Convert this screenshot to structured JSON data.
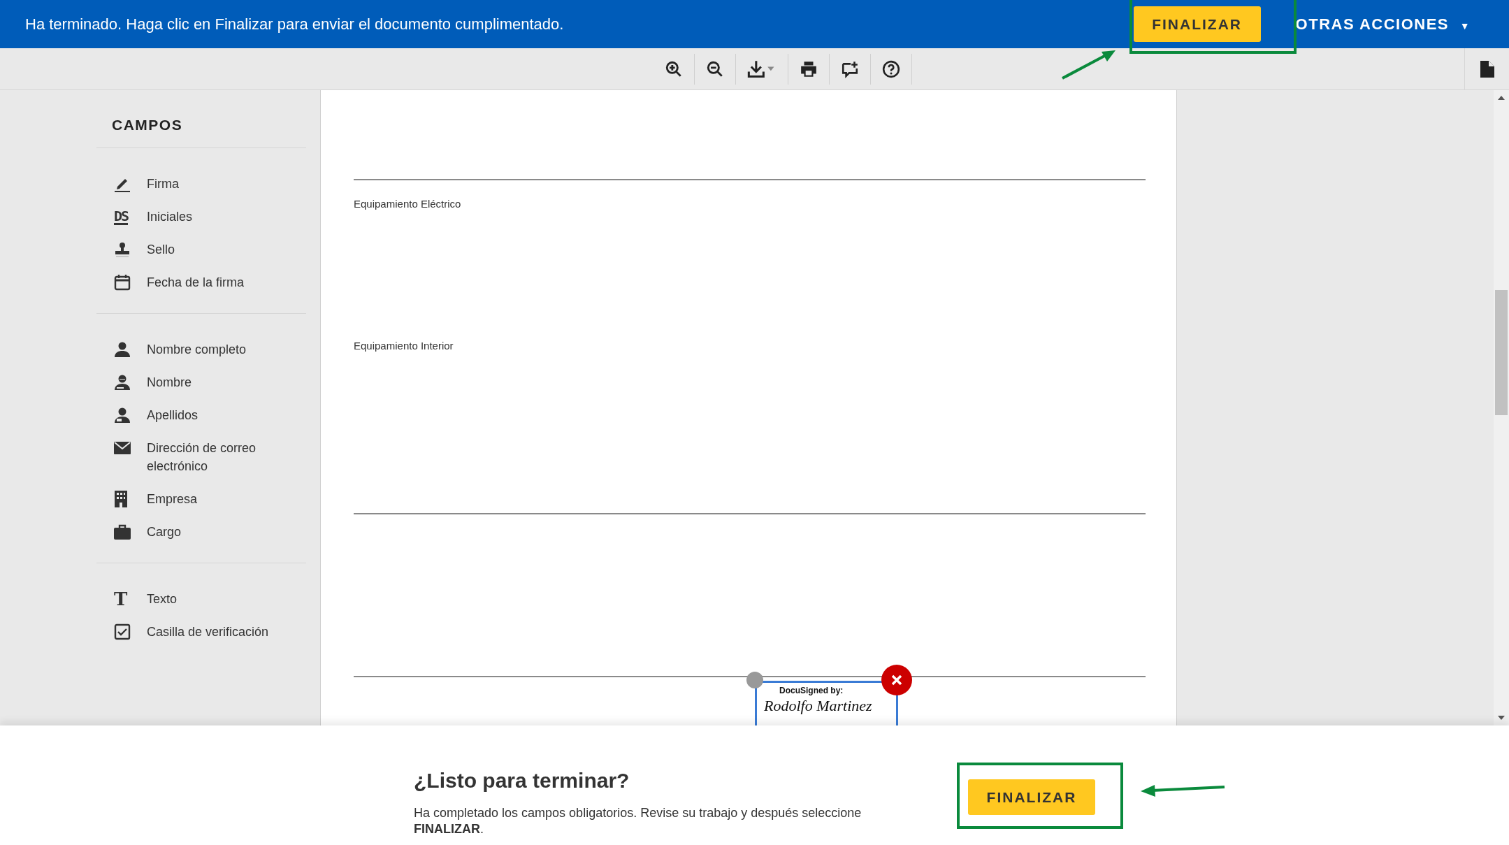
{
  "banner": {
    "message": "Ha terminado. Haga clic en Finalizar para enviar el documento cumplimentado.",
    "finish_button": "FINALIZAR",
    "more_actions": "OTRAS ACCIONES",
    "more_actions_caret": "▼"
  },
  "sidebar": {
    "title": "CAMPOS",
    "groups": [
      [
        {
          "label": "Firma",
          "kind": "signature"
        },
        {
          "label": "Iniciales",
          "kind": "initials",
          "icon_text": "DS"
        },
        {
          "label": "Sello",
          "kind": "stamp"
        },
        {
          "label": "Fecha de la firma",
          "kind": "date"
        }
      ],
      [
        {
          "label": "Nombre completo",
          "kind": "person"
        },
        {
          "label": "Nombre",
          "kind": "person-first"
        },
        {
          "label": "Apellidos",
          "kind": "person-last"
        },
        {
          "label": "Dirección de correo electrónico",
          "kind": "email"
        },
        {
          "label": "Empresa",
          "kind": "company"
        },
        {
          "label": "Cargo",
          "kind": "briefcase"
        }
      ],
      [
        {
          "label": "Texto",
          "kind": "text",
          "icon_text": "T"
        },
        {
          "label": "Casilla de verificación",
          "kind": "checkbox"
        }
      ]
    ]
  },
  "document": {
    "sections": [
      {
        "label": "Equipamiento Eléctrico"
      },
      {
        "label": "Equipamiento Interior"
      }
    ],
    "signature": {
      "header": "DocuSigned by:",
      "name": "Rodolfo Martinez"
    }
  },
  "footer": {
    "title": "¿Listo para terminar?",
    "text": "Ha completado los campos obligatorios. Revise su trabajo y después seleccione **FINALIZAR**.",
    "button": "FINALIZAR"
  }
}
